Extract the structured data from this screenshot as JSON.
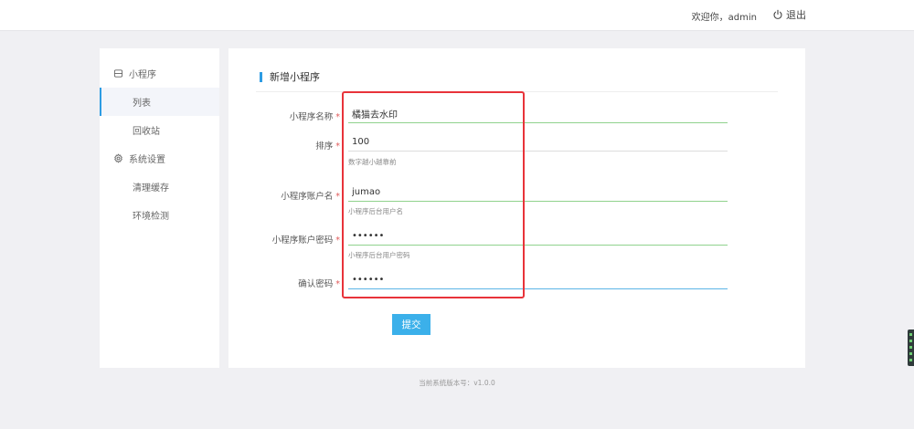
{
  "topbar": {
    "welcome": "欢迎你，admin",
    "logout_label": "退出"
  },
  "sidebar": {
    "groups": [
      {
        "title": "小程序",
        "icon": "mini-program-icon",
        "items": [
          {
            "label": "列表",
            "active": true
          },
          {
            "label": "回收站",
            "active": false
          }
        ]
      },
      {
        "title": "系统设置",
        "icon": "gear-icon",
        "items": [
          {
            "label": "清理缓存",
            "active": false
          },
          {
            "label": "环境检测",
            "active": false
          }
        ]
      }
    ]
  },
  "form": {
    "title": "新增小程序",
    "fields": [
      {
        "label": "小程序名称",
        "required": "*",
        "value": "橘猫去水印",
        "hint": ""
      },
      {
        "label": "排序",
        "required": "*",
        "value": "100",
        "hint": "数字越小越靠前"
      },
      {
        "label": "小程序账户名",
        "required": "*",
        "value": "jumao",
        "hint": "小程序后台用户名"
      },
      {
        "label": "小程序账户密码",
        "required": "*",
        "value": "••••••",
        "hint": "小程序后台用户密码"
      },
      {
        "label": "确认密码",
        "required": "*",
        "value": "••••••",
        "hint": ""
      }
    ],
    "submit_label": "提交"
  },
  "footer": {
    "version_text": "当前系统版本号：v1.0.0"
  },
  "colors": {
    "accent": "#2d9ce3",
    "button": "#3bb0ea",
    "highlight_box": "#e8333a",
    "required": "#e05a5a"
  }
}
